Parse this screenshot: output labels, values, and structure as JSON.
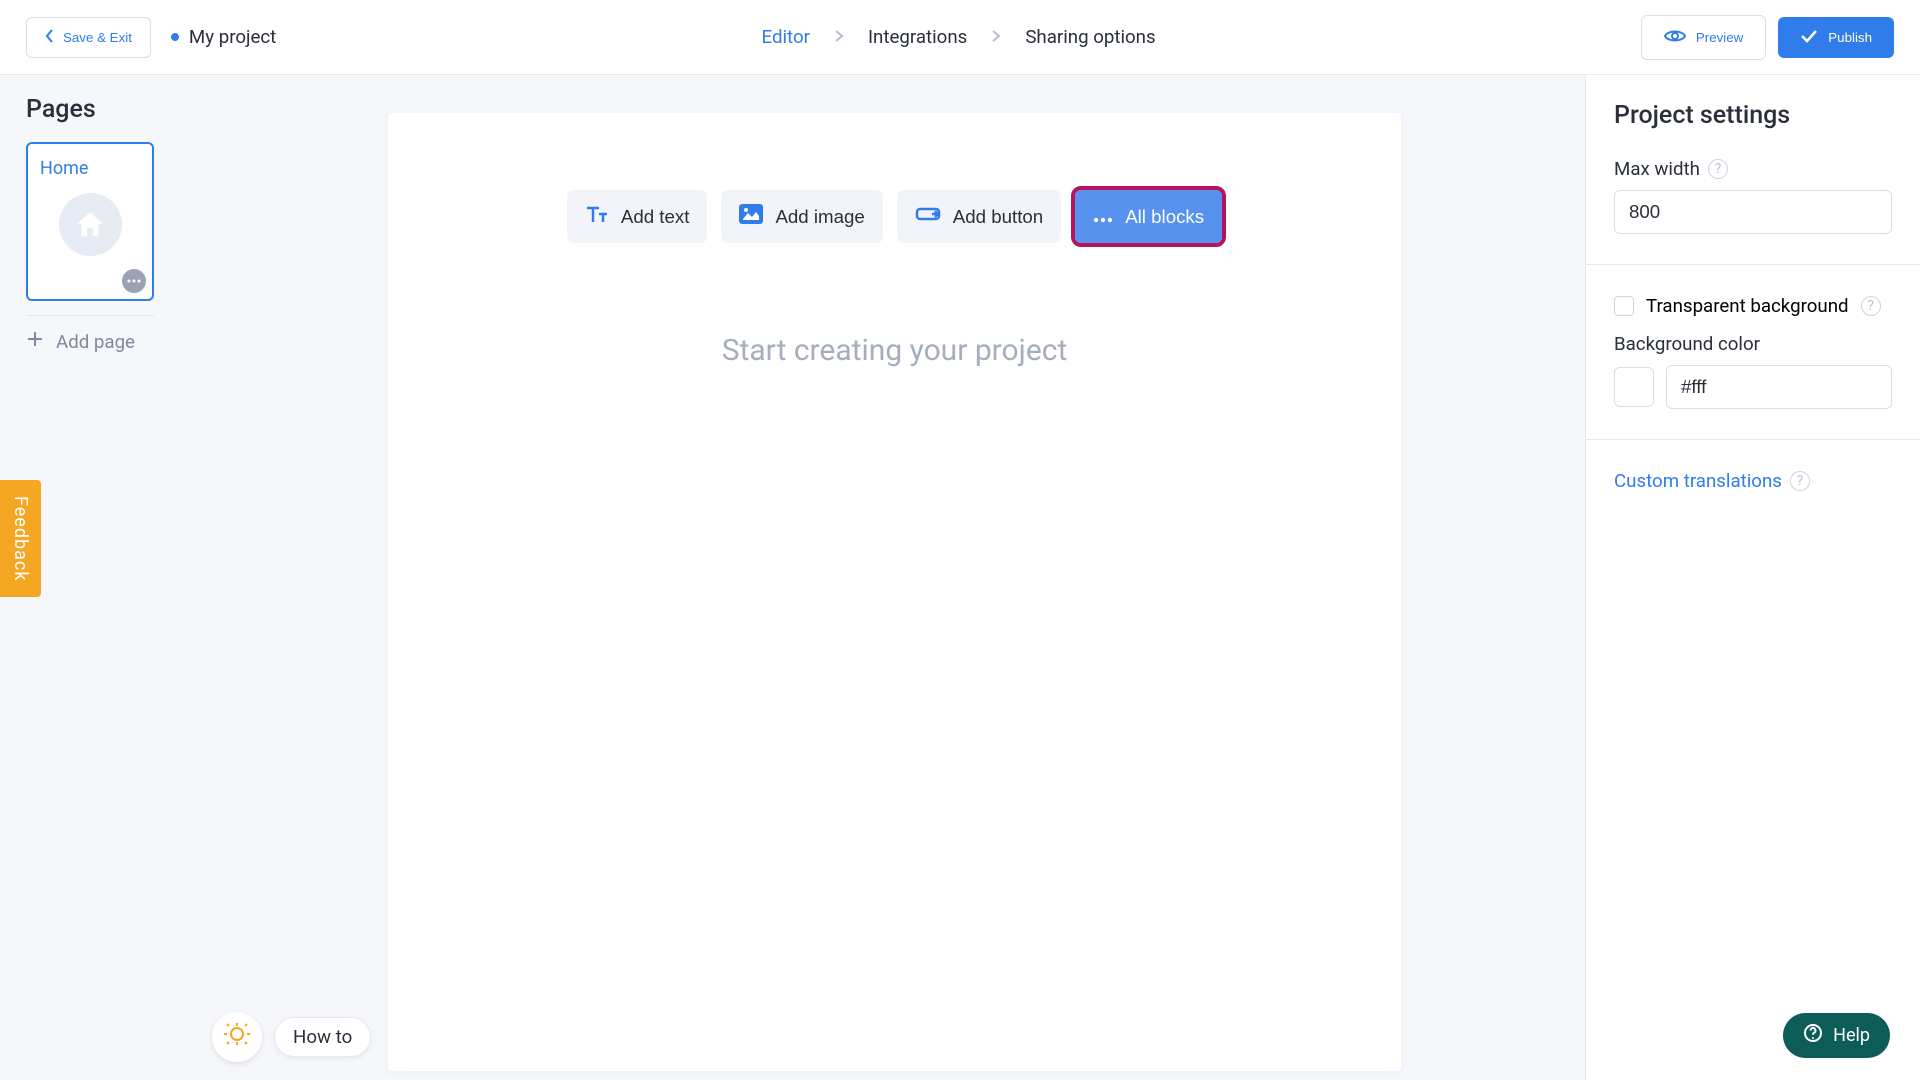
{
  "header": {
    "save_exit": "Save & Exit",
    "project_name": "My project",
    "nav": {
      "editor": "Editor",
      "integrations": "Integrations",
      "sharing": "Sharing options"
    },
    "preview": "Preview",
    "publish": "Publish"
  },
  "sidebar": {
    "title": "Pages",
    "home_label": "Home",
    "add_page": "Add page"
  },
  "feedback_label": "Feedback",
  "howto_label": "How to",
  "toolbar": {
    "add_text": "Add text",
    "add_image": "Add image",
    "add_button": "Add button",
    "all_blocks": "All blocks"
  },
  "canvas": {
    "placeholder": "Start creating your project"
  },
  "settings": {
    "title": "Project settings",
    "max_width_label": "Max width",
    "max_width_value": "800",
    "transparent_bg_label": "Transparent background",
    "bg_color_label": "Background color",
    "bg_color_value": "#fff",
    "custom_translations": "Custom translations"
  },
  "help_label": "Help"
}
